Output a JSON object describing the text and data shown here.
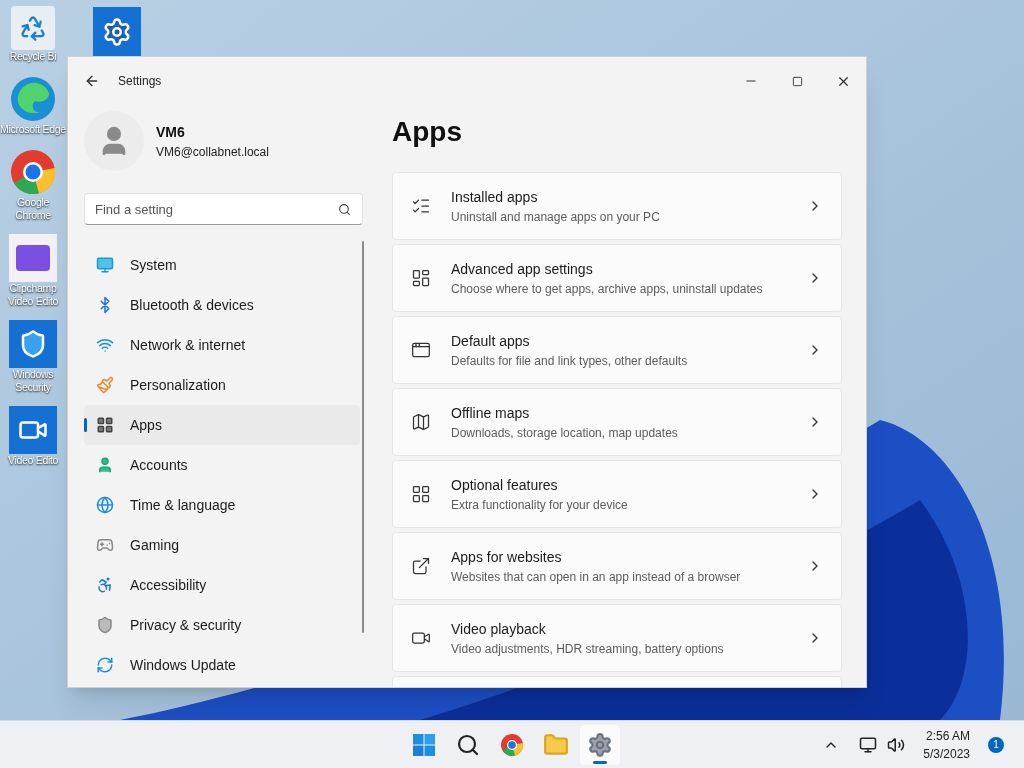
{
  "desktop_icons": [
    {
      "kind": "recycle",
      "label": "Recycle Bi"
    },
    {
      "kind": "edge",
      "label": "Microsoft Edge"
    },
    {
      "kind": "chrome",
      "label": "Google Chrome"
    },
    {
      "kind": "clipchamp",
      "label": "Clipchamp Video Edito"
    },
    {
      "kind": "security",
      "label": "Windows Security"
    },
    {
      "kind": "video",
      "label": "Video Edito"
    }
  ],
  "window": {
    "title": "Settings",
    "user": {
      "name": "VM6",
      "email": "VM6@collabnet.local"
    },
    "search": {
      "placeholder": "Find a setting"
    },
    "nav": [
      {
        "kind": "system",
        "label": "System",
        "selected": false
      },
      {
        "kind": "bluetooth",
        "label": "Bluetooth & devices",
        "selected": false
      },
      {
        "kind": "network",
        "label": "Network & internet",
        "selected": false
      },
      {
        "kind": "personalization",
        "label": "Personalization",
        "selected": false
      },
      {
        "kind": "apps",
        "label": "Apps",
        "selected": true
      },
      {
        "kind": "accounts",
        "label": "Accounts",
        "selected": false
      },
      {
        "kind": "time",
        "label": "Time & language",
        "selected": false
      },
      {
        "kind": "gaming",
        "label": "Gaming",
        "selected": false
      },
      {
        "kind": "accessibility",
        "label": "Accessibility",
        "selected": false
      },
      {
        "kind": "privacy",
        "label": "Privacy & security",
        "selected": false
      },
      {
        "kind": "update",
        "label": "Windows Update",
        "selected": false
      }
    ],
    "page_title": "Apps",
    "cards": [
      {
        "kind": "list",
        "title": "Installed apps",
        "subtitle": "Uninstall and manage apps on your PC"
      },
      {
        "kind": "advanced",
        "title": "Advanced app settings",
        "subtitle": "Choose where to get apps, archive apps, uninstall updates"
      },
      {
        "kind": "default",
        "title": "Default apps",
        "subtitle": "Defaults for file and link types, other defaults"
      },
      {
        "kind": "map",
        "title": "Offline maps",
        "subtitle": "Downloads, storage location, map updates"
      },
      {
        "kind": "features",
        "title": "Optional features",
        "subtitle": "Extra functionality for your device"
      },
      {
        "kind": "websites",
        "title": "Apps for websites",
        "subtitle": "Websites that can open in an app instead of a browser"
      },
      {
        "kind": "video",
        "title": "Video playback",
        "subtitle": "Video adjustments, HDR streaming, battery options"
      }
    ]
  },
  "taskbar": {
    "apps": [
      {
        "kind": "start",
        "selected": false
      },
      {
        "kind": "search",
        "selected": false
      },
      {
        "kind": "chrome",
        "selected": false
      },
      {
        "kind": "explorer",
        "selected": false
      },
      {
        "kind": "settings",
        "selected": true
      }
    ],
    "time": "2:56 AM",
    "date": "5/3/2023",
    "notification_count": "1"
  }
}
